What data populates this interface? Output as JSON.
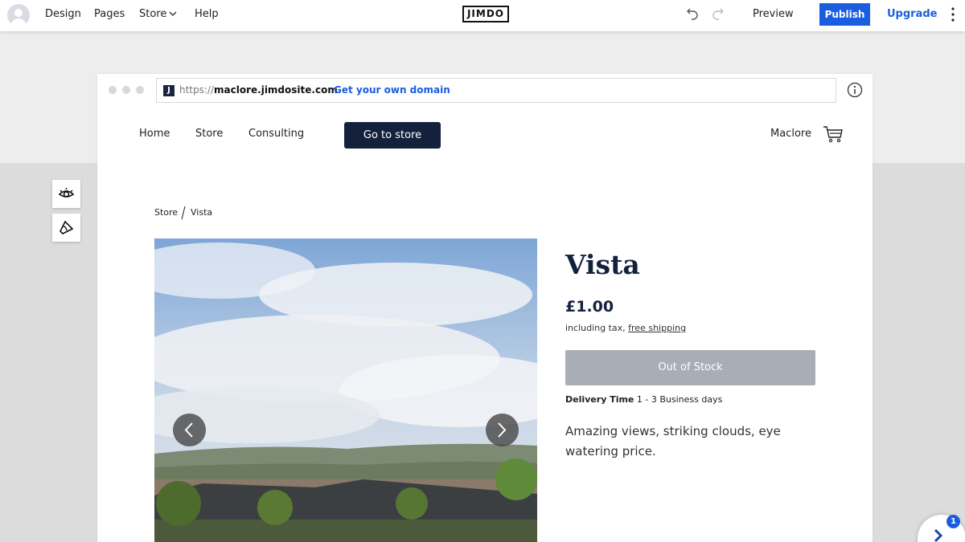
{
  "topbar": {
    "nav": [
      "Design",
      "Pages",
      "Store",
      "Help"
    ],
    "logo": "JIMDO",
    "preview": "Preview",
    "publish": "Publish",
    "upgrade": "Upgrade"
  },
  "browser": {
    "url_prefix": "https://",
    "url_domain": "maclore.jimdosite.com",
    "domain_link": "Get your own domain",
    "favicon": "J"
  },
  "site": {
    "nav": [
      "Home",
      "Store",
      "Consulting"
    ],
    "store_button": "Go to store",
    "brand": "Maclore"
  },
  "breadcrumb": [
    "Store",
    "Vista"
  ],
  "product": {
    "title": "Vista",
    "price": "£1.00",
    "tax_text": "including tax, ",
    "shipping_link": "free shipping",
    "stock_button": "Out of Stock",
    "delivery_label": "Delivery Time",
    "delivery_value": " 1 - 3 Business days",
    "description": "Amazing views, striking clouds, eye watering price."
  },
  "widget": {
    "badge": "1"
  },
  "colors": {
    "accent": "#1a5de0",
    "navy": "#14213d",
    "disabled": "#a9adb5"
  }
}
